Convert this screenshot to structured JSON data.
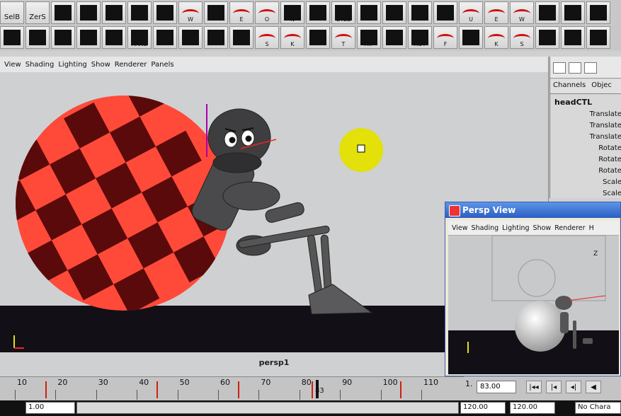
{
  "shelf": {
    "row1": [
      {
        "name": "mel-selb-tool",
        "label": "SelB",
        "mel": "mel"
      },
      {
        "name": "mel-zers-tool",
        "label": "ZerS",
        "mel": "mel"
      },
      {
        "name": "pose-tool-1",
        "label": ""
      },
      {
        "name": "pose-tool-2",
        "label": ""
      },
      {
        "name": "pose-tool-3",
        "label": ""
      },
      {
        "name": "pose-tool-4",
        "label": ""
      },
      {
        "name": "pose-tool-5",
        "label": ""
      },
      {
        "name": "mouth-w-tool",
        "label": "W",
        "curve": true
      },
      {
        "name": "heart-tool",
        "label": ""
      },
      {
        "name": "mouth-e-tool",
        "label": "E",
        "curve": true
      },
      {
        "name": "mouth-o-tool",
        "label": "O",
        "curve": true
      },
      {
        "name": "n-tool",
        "label": "N"
      },
      {
        "name": "face-tool",
        "label": ""
      },
      {
        "name": "eyes-tool",
        "label": "EYES"
      },
      {
        "name": "pose-tool-6",
        "label": ""
      },
      {
        "name": "pose-tool-7",
        "label": ""
      },
      {
        "name": "pose-tool-8",
        "label": ""
      },
      {
        "name": "pose-tool-9",
        "label": ""
      },
      {
        "name": "mouth-u-tool",
        "label": "U",
        "curve": true
      },
      {
        "name": "mouth-e2-tool",
        "label": "E",
        "curve": true
      },
      {
        "name": "mouth-w2-tool",
        "label": "W",
        "curve": true
      },
      {
        "name": "pose-tool-10",
        "label": ""
      },
      {
        "name": "pose-tool-11",
        "label": ""
      },
      {
        "name": "pose-tool-12",
        "label": ""
      }
    ],
    "row2": [
      {
        "name": "ctrl-tool-1",
        "label": ""
      },
      {
        "name": "ctrl-tool-2",
        "label": ""
      },
      {
        "name": "ctrl-tool-3",
        "label": ""
      },
      {
        "name": "ctrl-tool-4",
        "label": ""
      },
      {
        "name": "ctrl-tool-5",
        "label": ""
      },
      {
        "name": "hand-tool",
        "label": "HAND"
      },
      {
        "name": "ctrl-tool-6",
        "label": ""
      },
      {
        "name": "ctrl-tool-7",
        "label": ""
      },
      {
        "name": "ctrl-tool-8",
        "label": ""
      },
      {
        "name": "ctrl-tool-9",
        "label": ""
      },
      {
        "name": "mouth-s-tool",
        "label": "S",
        "curve": true
      },
      {
        "name": "mouth-k-tool",
        "label": "K",
        "curve": true
      },
      {
        "name": "ctrl-tool-10",
        "label": ""
      },
      {
        "name": "mouth-t-tool",
        "label": "T",
        "curve": true
      },
      {
        "name": "hip-tool",
        "label": "HIP"
      },
      {
        "name": "ctrl-tool-11",
        "label": ""
      },
      {
        "name": "rot-tool",
        "label": "ROT"
      },
      {
        "name": "mouth-f-tool",
        "label": "F",
        "curve": true
      },
      {
        "name": "ctrl-tool-12",
        "label": ""
      },
      {
        "name": "mouth-k2-tool",
        "label": "K",
        "curve": true
      },
      {
        "name": "mouth-s2-tool",
        "label": "S",
        "curve": true
      },
      {
        "name": "ctrl-tool-13",
        "label": ""
      },
      {
        "name": "ctrl-tool-14",
        "label": ""
      },
      {
        "name": "ctrl-tool-15",
        "label": ""
      }
    ]
  },
  "viewport": {
    "menu": [
      "View",
      "Shading",
      "Lighting",
      "Show",
      "Renderer",
      "Panels"
    ],
    "camera_label": "persp1",
    "axis_y": "Y",
    "colors": {
      "ball_red": "#ff4a3a",
      "ball_dark": "#5a0a0a",
      "floor": "#121016",
      "bg": "#cfd0d2",
      "highlight": "#e3e00a"
    }
  },
  "channel_box": {
    "tabs": [
      "Channels",
      "Objec"
    ],
    "node": "headCTL",
    "attributes": [
      "Translate",
      "Translate",
      "Translate",
      "Rotate",
      "Rotate",
      "Rotate",
      "Scale",
      "Scale"
    ]
  },
  "persp_window": {
    "title": "Persp View",
    "menu": [
      "View",
      "Shading",
      "Lighting",
      "Show",
      "Renderer",
      "H"
    ],
    "axis_label": "Z"
  },
  "timeline": {
    "ticks": [
      "10",
      "20",
      "30",
      "40",
      "50",
      "60",
      "70",
      "80",
      "90",
      "100",
      "110"
    ],
    "current_frame_marker": "83",
    "frame_start": "1.",
    "current_field": "83.00",
    "buttons": [
      "|◂◂",
      "|◂",
      "◂|",
      "◀"
    ]
  },
  "range": {
    "start": "1.00",
    "end_a": "120.00",
    "end_b": "120.00",
    "character": "No Chara"
  }
}
